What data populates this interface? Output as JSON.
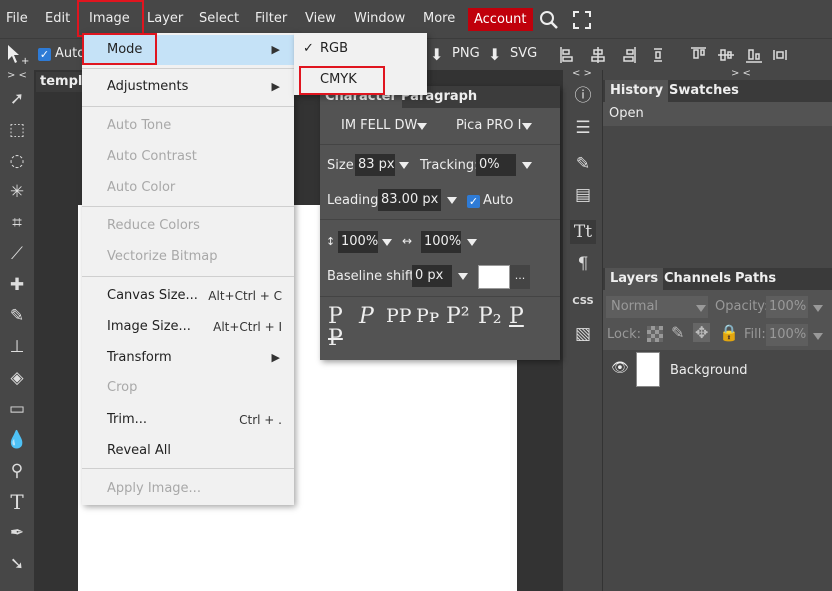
{
  "menubar": {
    "items": [
      "File",
      "Edit",
      "Image",
      "Layer",
      "Select",
      "Filter",
      "View",
      "Window",
      "More"
    ],
    "account": "Account"
  },
  "optbar": {
    "auto_label": "Auto",
    "png_label": "PNG",
    "svg_label": "SVG",
    "collapse_left": "> <",
    "collapse_right": "< >",
    "collapse_right2": "> <"
  },
  "document": {
    "tab_title": "templa"
  },
  "image_menu": {
    "mode": "Mode",
    "adjustments": "Adjustments",
    "auto_tone": "Auto Tone",
    "auto_contrast": "Auto Contrast",
    "auto_color": "Auto Color",
    "reduce_colors": "Reduce Colors",
    "vectorize_bitmap": "Vectorize Bitmap",
    "canvas_size": "Canvas Size...",
    "canvas_size_sc": "Alt+Ctrl + C",
    "image_size": "Image Size...",
    "image_size_sc": "Alt+Ctrl + I",
    "transform": "Transform",
    "crop": "Crop",
    "trim": "Trim...",
    "trim_sc": "Ctrl + .",
    "reveal_all": "Reveal All",
    "apply_image": "Apply Image..."
  },
  "mode_submenu": {
    "rgb": "RGB",
    "rgb_check": "✓",
    "cmyk": "CMYK"
  },
  "character_panel": {
    "tab_character": "Character",
    "tab_paragraph": "Paragraph",
    "font_family": "IM FELL DW",
    "font_style": "Pica PRO I",
    "size_label": "Size:",
    "size_value": "83 px",
    "tracking_label": "Tracking:",
    "tracking_value": "0%",
    "leading_label": "Leading:",
    "leading_value": "83.00 px",
    "auto_label": "Auto",
    "vscale_value": "100%",
    "hscale_value": "100%",
    "baseline_label": "Baseline shift:",
    "baseline_value": "0 px",
    "color_more": "..."
  },
  "panels": {
    "history_tab": "History",
    "swatches_tab": "Swatches",
    "history_items": [
      "Open"
    ],
    "layers_tab": "Layers",
    "channels_tab": "Channels",
    "paths_tab": "Paths",
    "blend_mode": "Normal",
    "opacity_label": "Opacity:",
    "opacity_value": "100%",
    "lock_label": "Lock:",
    "fill_label": "Fill:",
    "fill_value": "100%",
    "layer_name": "Background"
  },
  "right_tools": {
    "css_label": "CSS"
  },
  "colors": {
    "accent_red": "#c0000b",
    "highlight_red": "#e0151f",
    "menu_bg": "#f1f1f1",
    "ui_bg": "#474747"
  }
}
